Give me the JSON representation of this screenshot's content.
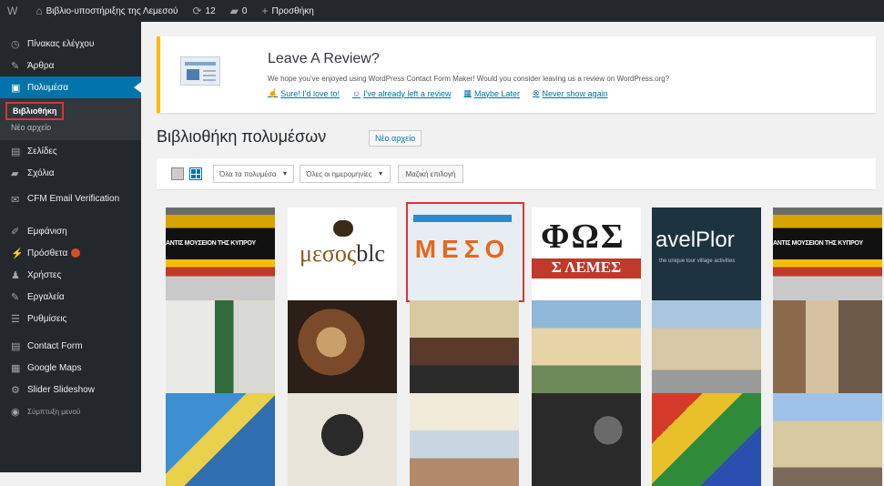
{
  "admin_bar": {
    "site_name": "Βιβλιο-υποστήριξης της Λεμεσού",
    "comments_count": "12",
    "updates_count": "0",
    "new_label": "Προσθήκη"
  },
  "sidebar": {
    "items": [
      {
        "label": "Πίνακας ελέγχου",
        "icon": "dashboard-icon"
      },
      {
        "label": "Άρθρα",
        "icon": "pin-icon"
      },
      {
        "label": "Πολυμέσα",
        "icon": "media-icon"
      },
      {
        "label": "Σελίδες",
        "icon": "pages-icon"
      },
      {
        "label": "Σχόλια",
        "icon": "comments-icon"
      },
      {
        "label": "CFM Email Verification",
        "icon": "email-icon"
      },
      {
        "label": "Εμφάνιση",
        "icon": "brush-icon"
      },
      {
        "label": "Πρόσθετα",
        "icon": "plugins-icon"
      },
      {
        "label": "Χρήστες",
        "icon": "users-icon"
      },
      {
        "label": "Εργαλεία",
        "icon": "tools-icon"
      },
      {
        "label": "Ρυθμίσεις",
        "icon": "settings-icon"
      },
      {
        "label": "Contact Form",
        "icon": "form-icon"
      },
      {
        "label": "Google Maps",
        "icon": "map-icon"
      },
      {
        "label": "Slider Slideshow",
        "icon": "slider-icon"
      },
      {
        "label": "Σύμπτυξη μενού",
        "icon": "collapse-icon"
      }
    ],
    "submenu": {
      "library": "Βιβλιοθήκη",
      "add_new": "Νέο αρχείο"
    },
    "plugins_badge": "1"
  },
  "notice": {
    "title": "Leave A Review?",
    "text": "We hope you've enjoyed using WordPress Contact Form Maker! Would you consider leaving us a review on WordPress.org?",
    "links": [
      {
        "label": "Sure! I'd love to!",
        "icon": "thumbs-up-icon"
      },
      {
        "label": "I've already left a review",
        "icon": "smile-icon"
      },
      {
        "label": "Maybe Later",
        "icon": "calendar-icon"
      },
      {
        "label": "Never show again",
        "icon": "close-circle-icon"
      }
    ]
  },
  "page": {
    "title": "Βιβλιοθήκη πολυμέσων",
    "add_new": "Νέο αρχείο"
  },
  "toolbar": {
    "filter_type": "Όλα τα πολυμέσα",
    "filter_date": "Όλες οι ημερομηνίες",
    "bulk_select": "Μαζική επιλογή"
  },
  "media": {
    "stripe_text": "ΑΝΤΙΣ ΜΟΥΣΕΙΟΝ ΤΗΣ ΚΥΠΡΟΥ",
    "meso_left": "μεσος",
    "meso_right": "blc",
    "meso_big": "ΜΕΣΟ",
    "fos_big": "ΦΩΣ",
    "fos_red": "Σ ΛΕΜΕΣ",
    "travel": "avelPlor",
    "travel_sub": "the unique tour village activities"
  },
  "colors": {
    "admin_bg": "#23282d",
    "accent": "#0073aa",
    "highlight_box": "#d63638",
    "notice_border": "#ffb900"
  }
}
